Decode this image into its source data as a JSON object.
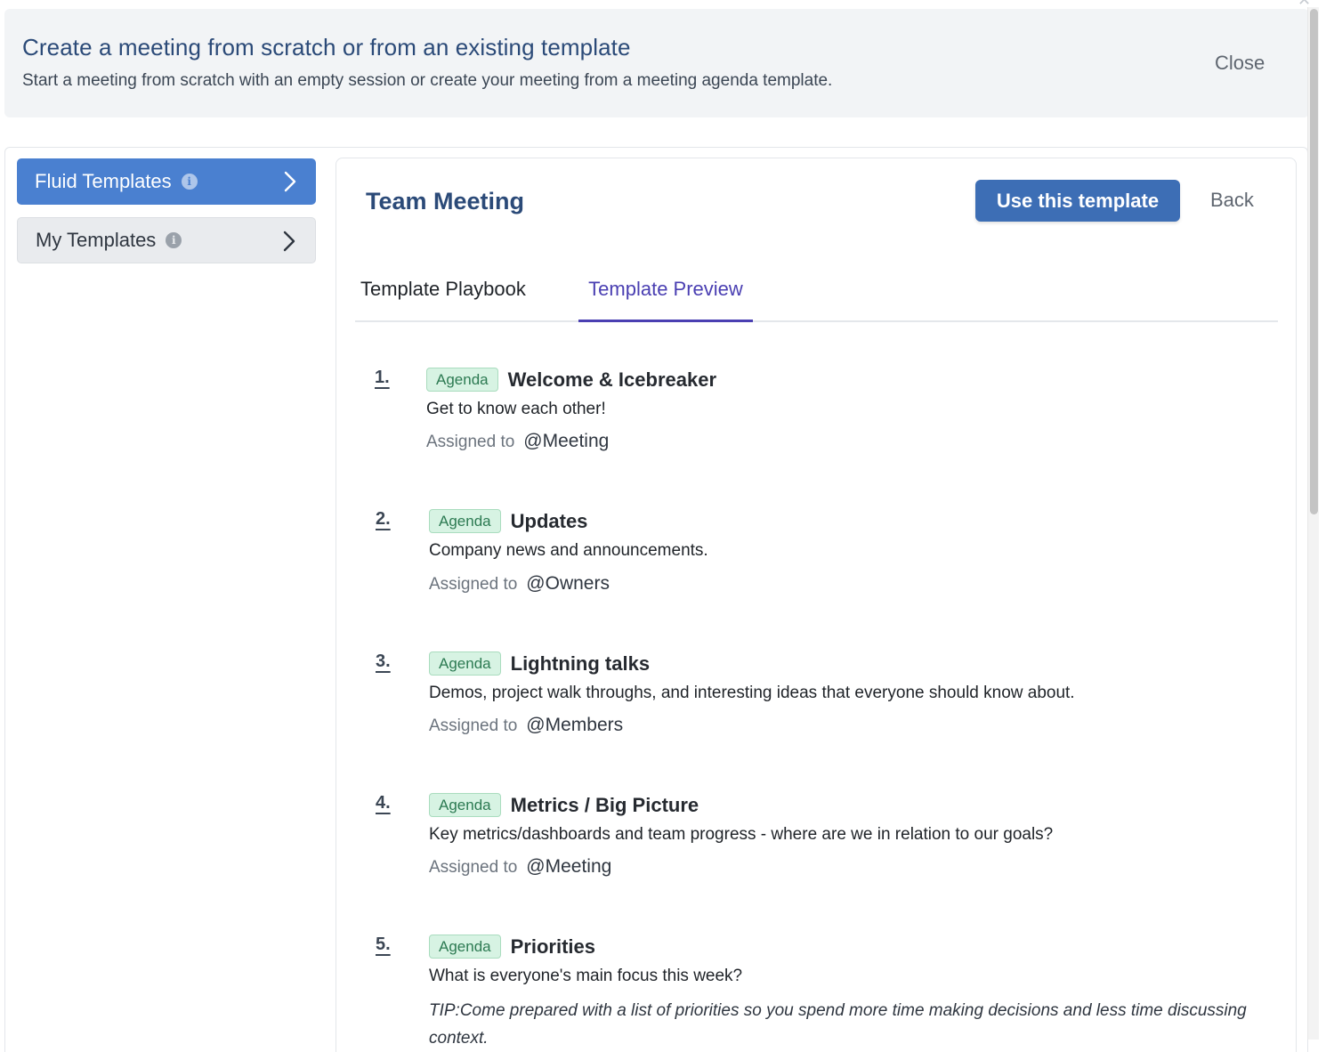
{
  "header": {
    "title": "Create a meeting from scratch or from an existing template",
    "subtitle": "Start a meeting from scratch with an empty session or create your meeting from a meeting agenda template.",
    "close_label": "Close"
  },
  "sidebar": {
    "items": [
      {
        "label": "Fluid Templates",
        "active": true
      },
      {
        "label": "My Templates",
        "active": false
      }
    ]
  },
  "template": {
    "title": "Team Meeting",
    "use_button": "Use this template",
    "back_button": "Back"
  },
  "tabs": [
    {
      "label": "Template Playbook",
      "active": false
    },
    {
      "label": "Template Preview",
      "active": true
    }
  ],
  "assigned_label": "Assigned to",
  "agenda": [
    {
      "number": "1.",
      "badge": "Agenda",
      "title": "Welcome & Icebreaker",
      "description": "Get to know each other!",
      "assignee": "@Meeting"
    },
    {
      "number": "2.",
      "badge": "Agenda",
      "title": "Updates",
      "description": "Company news and announcements.",
      "assignee": "@Owners"
    },
    {
      "number": "3.",
      "badge": "Agenda",
      "title": "Lightning talks",
      "description": "Demos, project walk throughs, and interesting ideas that everyone should know about.",
      "assignee": "@Members"
    },
    {
      "number": "4.",
      "badge": "Agenda",
      "title": "Metrics / Big Picture",
      "description": "Key metrics/dashboards and team progress - where are we in relation to our goals?",
      "assignee": "@Meeting"
    },
    {
      "number": "5.",
      "badge": "Agenda",
      "title": "Priorities",
      "description": "What is everyone's main focus this week?",
      "tip": "TIP:Come prepared with a list of priorities so you spend more time making decisions and less time discussing context."
    }
  ],
  "colors": {
    "brand_blue": "#2b4a78",
    "sidebar_active": "#4a80d0",
    "primary_button": "#3d6eb5",
    "tab_active": "#4a3fb2",
    "badge_bg": "#d7f3e3",
    "badge_text": "#2c7a52"
  },
  "icons": {
    "info": "info-icon",
    "chevron": "chevron-right-icon",
    "close": "close-icon"
  }
}
